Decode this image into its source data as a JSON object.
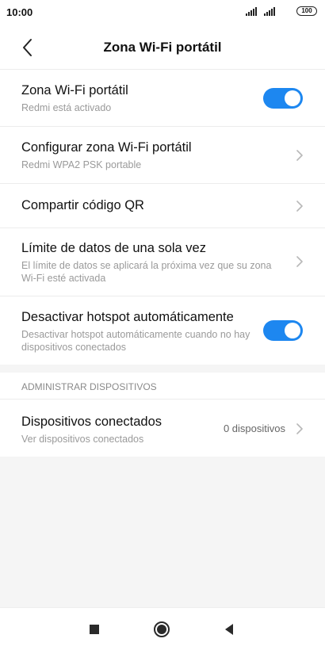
{
  "status_bar": {
    "time": "10:00",
    "battery": "100"
  },
  "header": {
    "title": "Zona Wi-Fi portátil",
    "back_icon": "chevron-left-icon"
  },
  "settings": [
    {
      "title": "Zona Wi-Fi portátil",
      "subtitle": "Redmi está activado",
      "control": "toggle",
      "enabled": true
    },
    {
      "title": "Configurar zona Wi-Fi portátil",
      "subtitle": "Redmi WPA2 PSK portable",
      "control": "chevron"
    },
    {
      "title": "Compartir código QR",
      "control": "chevron"
    },
    {
      "title": "Límite de datos de una sola vez",
      "subtitle": "El límite de datos se aplicará la próxima vez que su zona Wi-Fi esté activada",
      "control": "chevron"
    },
    {
      "title": "Desactivar hotspot automáticamente",
      "subtitle": "Desactivar hotspot automáticamente cuando no hay dispositivos conectados",
      "control": "toggle",
      "enabled": true
    }
  ],
  "devices_section": {
    "header": "ADMINISTRAR DISPOSITIVOS",
    "item": {
      "title": "Dispositivos conectados",
      "subtitle": "Ver dispositivos conectados",
      "value": "0 dispositivos"
    }
  },
  "nav": {
    "recents_icon": "square-icon",
    "home_icon": "circle-icon",
    "back_icon": "triangle-back-icon"
  },
  "colors": {
    "accent": "#1d87f0",
    "background": "#f5f5f5",
    "divider": "#ececec"
  }
}
